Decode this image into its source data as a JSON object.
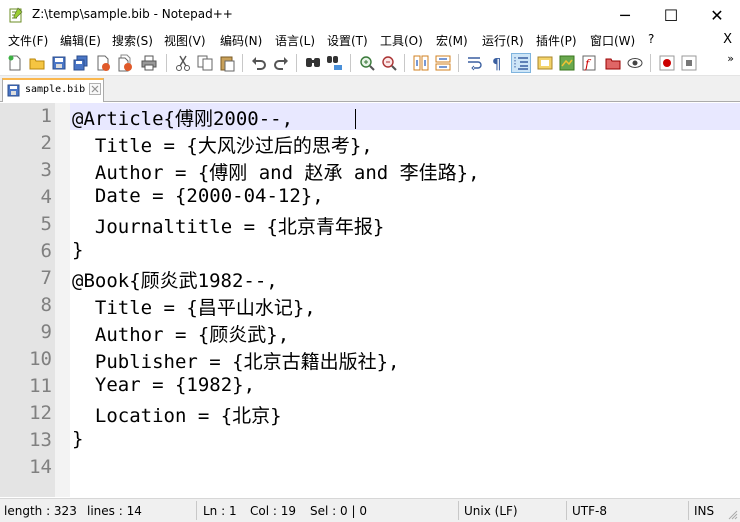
{
  "window": {
    "title": "Z:\\temp\\sample.bib - Notepad++",
    "minimize_glyph": "─",
    "maximize_glyph": "☐",
    "close_glyph": "✕"
  },
  "menu": {
    "items": [
      "文件(F)",
      "编辑(E)",
      "搜索(S)",
      "视图(V)",
      "编码(N)",
      "语言(L)",
      "设置(T)",
      "工具(O)",
      "宏(M)",
      "运行(R)",
      "插件(P)",
      "窗口(W)",
      "?"
    ],
    "close_doc": "X"
  },
  "toolbar": {
    "icons": [
      "new-file-icon",
      "open-file-icon",
      "save-icon",
      "save-all-icon",
      "close-icon",
      "close-all-icon",
      "print-icon",
      "cut-icon",
      "copy-icon",
      "paste-icon",
      "undo-icon",
      "redo-icon",
      "find-icon",
      "replace-icon",
      "zoom-in-icon",
      "zoom-out-icon",
      "sync-vertical-icon",
      "sync-horizontal-icon",
      "word-wrap-icon",
      "show-all-chars-icon",
      "indent-guide-icon",
      "udl-icon",
      "document-map-icon",
      "function-list-icon",
      "folder-workspace-icon",
      "monitoring-icon",
      "record-macro-icon",
      "stop-record-icon"
    ],
    "more_glyph": "»"
  },
  "tab": {
    "label": "sample.bib"
  },
  "editor": {
    "lines": [
      "@Article{傅刚2000--,",
      "  Title = {大风沙过后的思考},",
      "  Author = {傅刚 and 赵承 and 李佳路},",
      "  Date = {2000-04-12},",
      "  Journaltitle = {北京青年报}",
      "}",
      "@Book{顾炎武1982--,",
      "  Title = {昌平山水记},",
      "  Author = {顾炎武},",
      "  Publisher = {北京古籍出版社},",
      "  Year = {1982},",
      "  Location = {北京}",
      "}",
      ""
    ],
    "line_numbers": [
      "1",
      "2",
      "3",
      "4",
      "5",
      "6",
      "7",
      "8",
      "9",
      "10",
      "11",
      "12",
      "13",
      "14"
    ],
    "current_line": 1
  },
  "status": {
    "length": "length : 323",
    "lines": "lines : 14",
    "ln": "Ln : 1",
    "col": "Col : 19",
    "sel": "Sel : 0 | 0",
    "eol": "Unix (LF)",
    "encoding": "UTF-8",
    "mode": "INS"
  }
}
